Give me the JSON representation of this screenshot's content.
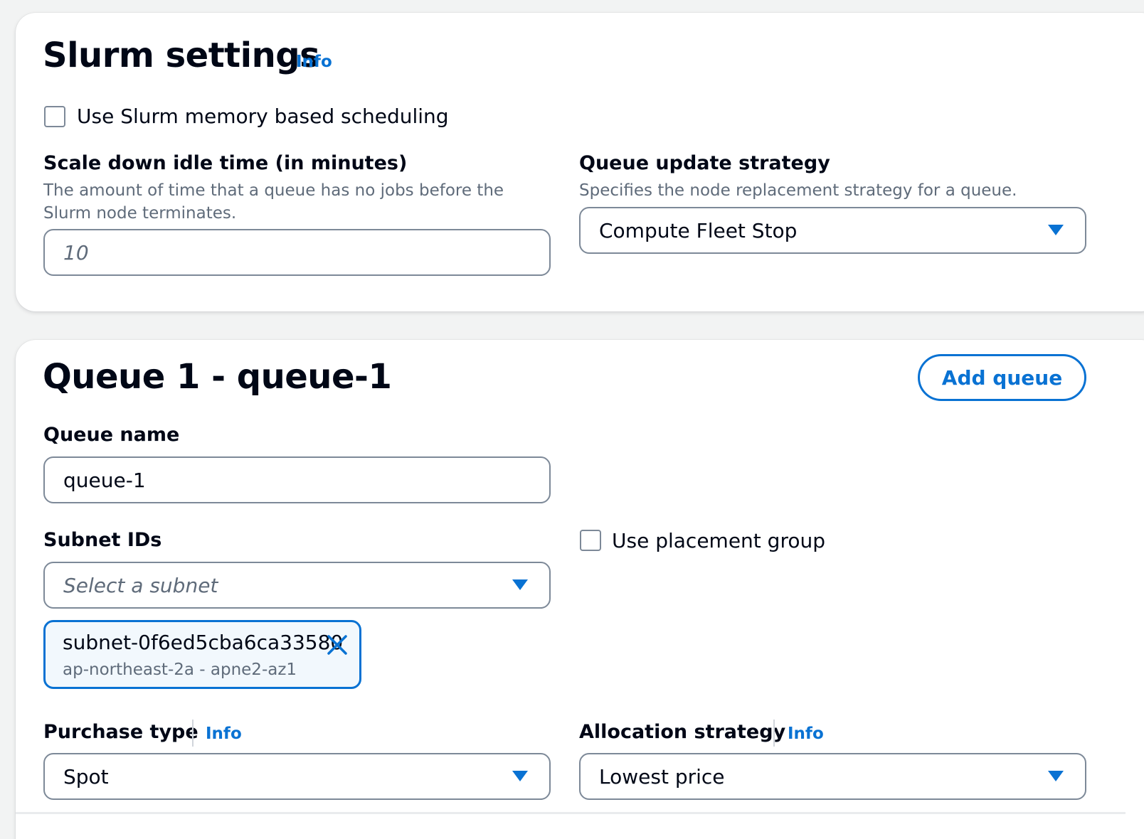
{
  "slurm_settings": {
    "title": "Slurm settings",
    "info_label": "Info",
    "memory_checkbox_label": "Use Slurm memory based scheduling",
    "memory_checked": false,
    "scale_down": {
      "label": "Scale down idle time (in minutes)",
      "description": "The amount of time that a queue has no jobs before the Slurm node terminates.",
      "placeholder": "10"
    },
    "queue_update": {
      "label": "Queue update strategy",
      "description": "Specifies the node replacement strategy for a queue.",
      "value": "Compute Fleet Stop"
    }
  },
  "queue": {
    "title": "Queue 1 - queue-1",
    "add_queue_label": "Add queue",
    "queue_name": {
      "label": "Queue name",
      "value": "queue-1"
    },
    "subnet_ids": {
      "label": "Subnet IDs",
      "placeholder": "Select a subnet",
      "token": {
        "id": "subnet-0f6ed5cba6ca33580",
        "description": "ap-northeast-2a - apne2-az1"
      }
    },
    "placement_group": {
      "label": "Use placement group",
      "checked": false
    },
    "purchase_type": {
      "label": "Purchase type",
      "info_label": "Info",
      "value": "Spot"
    },
    "allocation_strategy": {
      "label": "Allocation strategy",
      "info_label": "Info",
      "value": "Lowest price"
    }
  },
  "colors": {
    "accent": "#0972d3",
    "border": "#7d8998",
    "text": "#000716",
    "secondary_text": "#5f6b7a"
  },
  "icons": {
    "caret": "caret-down-icon",
    "remove": "close-icon"
  }
}
